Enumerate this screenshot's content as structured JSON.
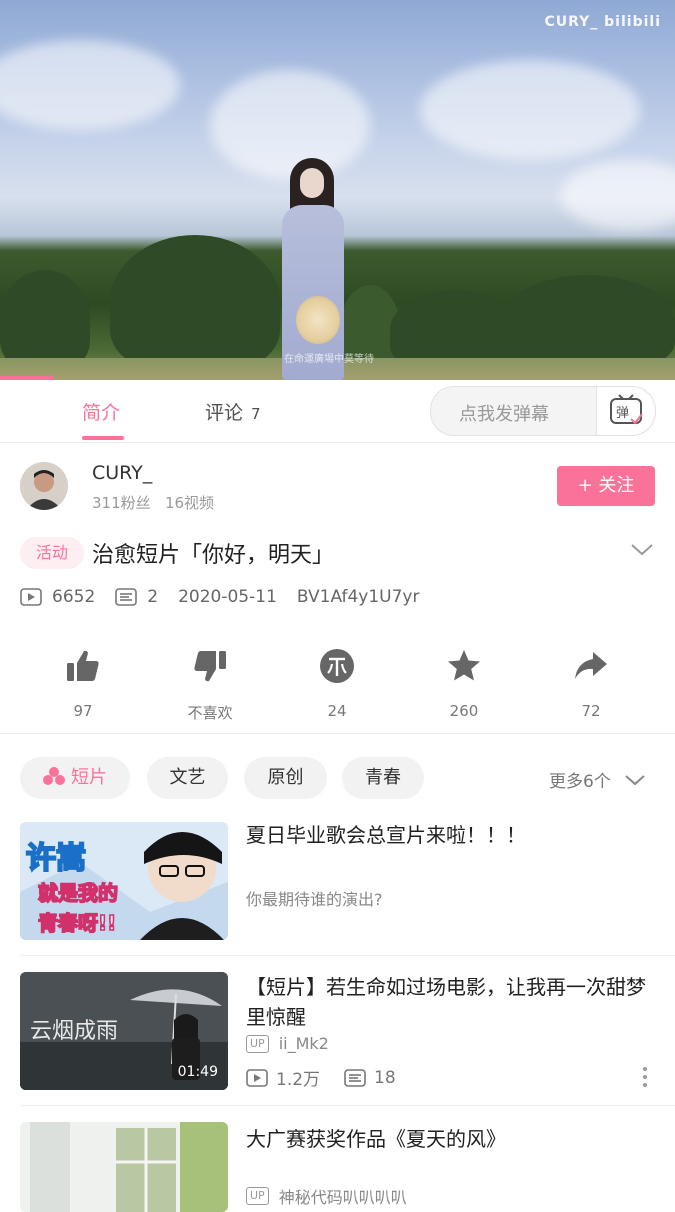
{
  "video": {
    "watermark": "CURY_ bilibili",
    "subtitle": "在命運廣場中莫等待",
    "progress": 0.08
  },
  "tabs": {
    "intro": "简介",
    "comments": "评论",
    "comment_count": "7",
    "danmu_placeholder": "点我发弹幕",
    "danmu_icon_text": "弹"
  },
  "uploader": {
    "name": "CURY_",
    "fans": "311粉丝",
    "videos": "16视频",
    "follow": "+ 关注"
  },
  "video_info": {
    "tag": "活动",
    "title": "治愈短片「你好，明天」",
    "plays": "6652",
    "danmaku": "2",
    "date": "2020-05-11",
    "bvid": "BV1Af4y1U7yr"
  },
  "actions": {
    "like": "97",
    "dislike": "不喜欢",
    "coin": "24",
    "favorite": "260",
    "share": "72"
  },
  "tags": {
    "items": [
      "短片",
      "文艺",
      "原创",
      "青春"
    ],
    "more": "更多6个"
  },
  "related": [
    {
      "title": "夏日毕业歌会总宣片来啦！！！",
      "subtitle": "你最期待谁的演出?",
      "thumb_text1": "许嵩",
      "thumb_text2": "就是我的",
      "thumb_text3": "青春呀!!"
    },
    {
      "title": "【短片】若生命如过场电影，让我再一次甜梦里惊醒",
      "up_badge": "UP",
      "uploader": "ii_Mk2",
      "plays": "1.2万",
      "danmaku": "18",
      "duration": "01:49",
      "thumb_text": "云烟成雨"
    },
    {
      "title": "大广赛获奖作品《夏天的风》",
      "up_badge": "UP",
      "uploader": "神秘代码叭叭叭叭"
    }
  ],
  "colors": {
    "accent": "#fb7299"
  }
}
